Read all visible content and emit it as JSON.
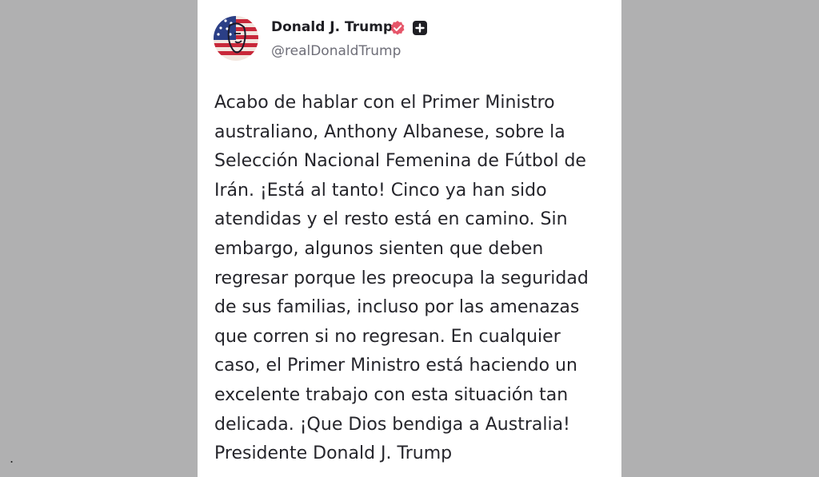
{
  "background_color": "#b0b0b1",
  "stray_mark": ".",
  "post": {
    "author": {
      "display_name": "Donald J. Trump",
      "handle": "@realDonaldTrump",
      "avatar_icon": "flag-portrait-avatar",
      "verified_icon": "verified-badge-icon",
      "verified_color": "#e6566a",
      "extra_icon": "plus-square-icon"
    },
    "text_lines": [
      "Acabo de hablar con el Primer Ministro",
      "australiano, Anthony Albanese, sobre la",
      "Selección Nacional Femenina de Fútbol de",
      "Irán. ¡Está al tanto! Cinco ya han sido",
      "atendidas y el resto está en camino. Sin",
      "embargo, algunos sienten que deben",
      "regresar porque les preocupa la seguridad",
      "de sus familias, incluso por las amenazas",
      "que corren si no regresan. En cualquier",
      "caso, el Primer Ministro está haciendo un",
      "excelente trabajo con esta situación tan",
      "delicada. ¡Que Dios bendiga a Australia!",
      "Presidente Donald J. Trump"
    ]
  }
}
